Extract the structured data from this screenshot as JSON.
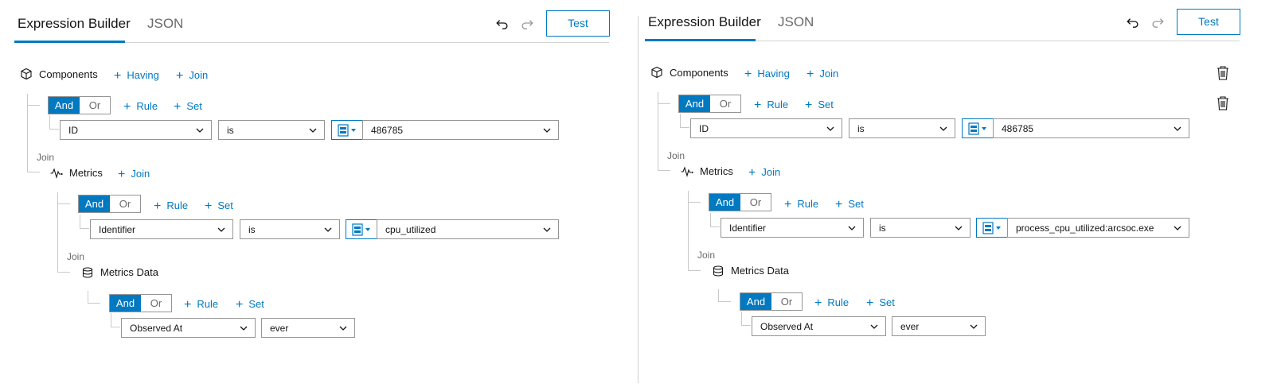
{
  "tabs": {
    "builder": "Expression Builder",
    "json": "JSON"
  },
  "test_label": "Test",
  "components": {
    "label": "Components"
  },
  "actions": {
    "having": "Having",
    "join": "Join",
    "rule": "Rule",
    "set": "Set"
  },
  "logic": {
    "and": "And",
    "or": "Or"
  },
  "join_label": "Join",
  "metrics": {
    "label": "Metrics"
  },
  "metrics_data": {
    "label": "Metrics Data"
  },
  "left": {
    "rule1": {
      "field": "ID",
      "op": "is",
      "value": "486785"
    },
    "rule2": {
      "field": "Identifier",
      "op": "is",
      "value": "cpu_utilized"
    },
    "rule3": {
      "field": "Observed At",
      "op": "ever"
    }
  },
  "right": {
    "rule1": {
      "field": "ID",
      "op": "is",
      "value": "486785"
    },
    "rule2": {
      "field": "Identifier",
      "op": "is",
      "value": "process_cpu_utilized:arcsoc.exe"
    },
    "rule3": {
      "field": "Observed At",
      "op": "ever"
    }
  },
  "colors": {
    "accent": "#0079c1",
    "border": "#959595",
    "line": "#c9c9c9"
  },
  "icons": [
    "undo-icon",
    "redo-icon",
    "cube-icon",
    "pulse-icon",
    "database-icon",
    "field-type-icon",
    "chevron-down-icon",
    "trash-icon"
  ]
}
